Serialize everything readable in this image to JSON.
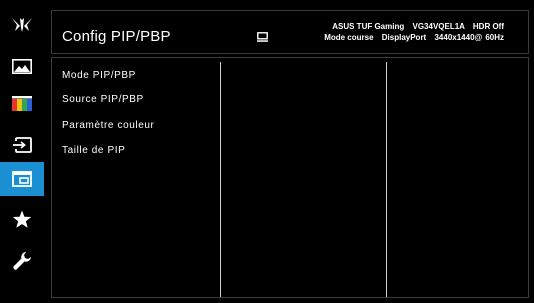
{
  "window": {
    "title": "Config PIP/PBP"
  },
  "sidebar": {
    "items": [
      {
        "name": "logo",
        "icon": "tuf-logo-icon"
      },
      {
        "name": "image",
        "icon": "landscape-picture-icon"
      },
      {
        "name": "color",
        "icon": "color-bars-icon"
      },
      {
        "name": "input-select",
        "icon": "input-arrow-icon"
      },
      {
        "name": "pip-pbp",
        "icon": "pip-window-icon",
        "active": true
      },
      {
        "name": "favorite",
        "icon": "star-icon"
      },
      {
        "name": "system-setup",
        "icon": "wrench-icon"
      }
    ]
  },
  "header": {
    "title": "Config PIP/PBP",
    "input_icon": "monitor-input-icon",
    "info": {
      "brand": "ASUS TUF Gaming",
      "model": "VG34VQEL1A",
      "hdr": "HDR Off",
      "mode": "Mode course",
      "input": "DisplayPort",
      "resolution": "3440x1440@",
      "refresh": "60Hz"
    }
  },
  "menu": {
    "items": [
      {
        "label": "Mode PIP/PBP"
      },
      {
        "label": "Source PIP/PBP"
      },
      {
        "label": "Paramètre couleur"
      },
      {
        "label": "Taille de PIP"
      }
    ]
  },
  "colors": {
    "accent": "#1a8fd1",
    "background": "#000000",
    "text": "#ffffff",
    "border": "#3a3a3a"
  }
}
